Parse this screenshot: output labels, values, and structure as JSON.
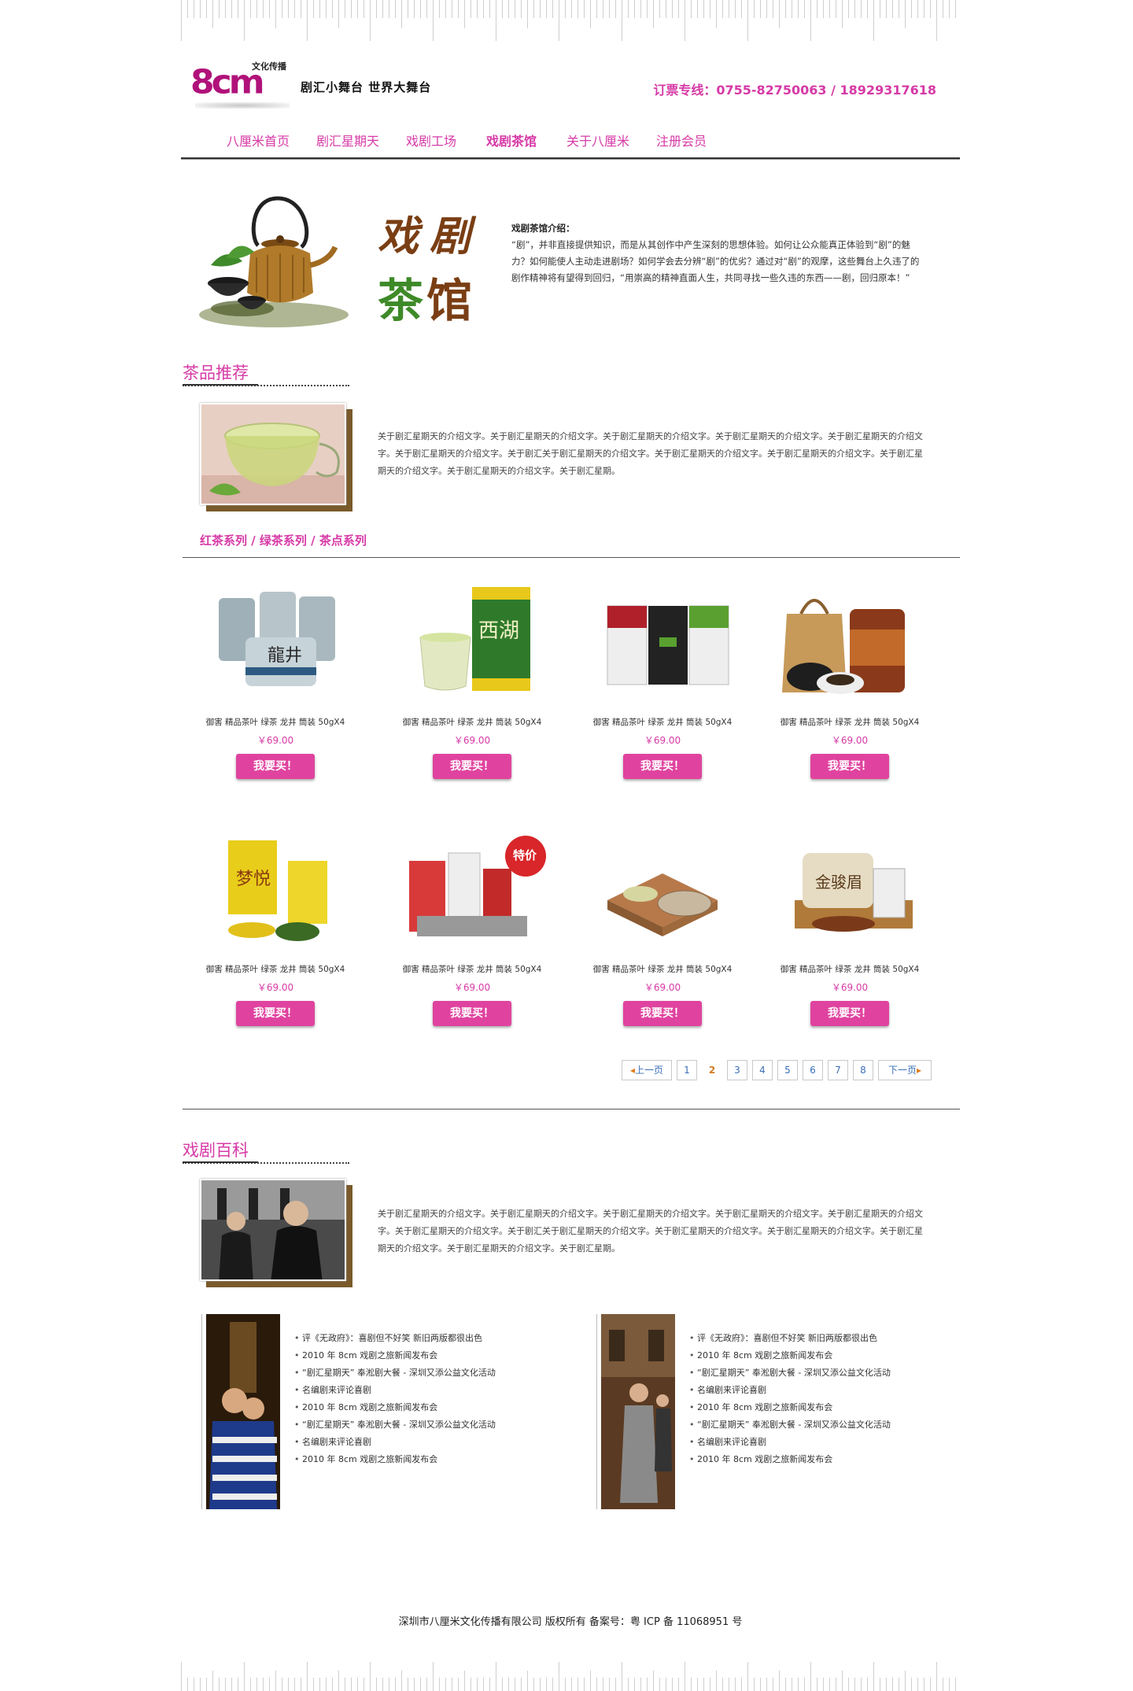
{
  "header": {
    "logo_text": "8cm",
    "logo_tag": "文化传播",
    "slogan": "剧汇小舞台  世界大舞台",
    "hotline": "订票专线：0755-82750063 / 18929317618"
  },
  "nav": [
    {
      "label": "八厘米首页"
    },
    {
      "label": "剧汇星期天"
    },
    {
      "label": "戏剧工场"
    },
    {
      "label": "戏剧茶馆",
      "active": true
    },
    {
      "label": "关于八厘米"
    },
    {
      "label": "注册会员"
    }
  ],
  "banner": {
    "title_line1": "戏剧",
    "title_line2a": "茶",
    "title_line2b": "馆",
    "intro_head": "戏剧茶馆介绍：",
    "intro_body": "“剧”，并非直接提供知识，而是从其创作中产生深刻的思想体验。如何让公众能真正体验到“剧”的魅力？如何能使人主动走进剧场？如何学会去分辨“剧”的优劣？通过对“剧”的观摩，这些舞台上久违了的剧作精神将有望得到回归，“用崇高的精神直面人生，共同寻找一些久违的东西——剧，回归原本！”"
  },
  "tea_section": {
    "title": "茶品推荐",
    "text": "关于剧汇星期天的介绍文字。关于剧汇星期天的介绍文字。关于剧汇星期天的介绍文字。关于剧汇星期天的介绍文字。关于剧汇星期天的介绍文字。关于剧汇星期天的介绍文字。关于剧汇关于剧汇星期天的介绍文字。关于剧汇星期天的介绍文字。关于剧汇星期天的介绍文字。关于剧汇星期天的介绍文字。关于剧汇星期天的介绍文字。关于剧汇星期。",
    "series": "红茶系列 / 绿茶系列 / 茶点系列"
  },
  "products": [
    {
      "name": "御害  精品茶叶  绿茶  龙井  筒装  50gX4",
      "price": "￥69.00",
      "buy": "我要买！"
    },
    {
      "name": "御害  精品茶叶  绿茶  龙井  筒装  50gX4",
      "price": "￥69.00",
      "buy": "我要买！"
    },
    {
      "name": "御害  精品茶叶  绿茶  龙井  筒装  50gX4",
      "price": "￥69.00",
      "buy": "我要买！"
    },
    {
      "name": "御害  精品茶叶  绿茶  龙井  筒装  50gX4",
      "price": "￥69.00",
      "buy": "我要买！"
    },
    {
      "name": "御害  精品茶叶  绿茶  龙井  筒装  50gX4",
      "price": "￥69.00",
      "buy": "我要买！"
    },
    {
      "name": "御害  精品茶叶  绿茶  龙井  筒装  50gX4",
      "price": "￥69.00",
      "buy": "我要买！",
      "badge": "特价"
    },
    {
      "name": "御害  精品茶叶  绿茶  龙井  筒装  50gX4",
      "price": "￥69.00",
      "buy": "我要买！"
    },
    {
      "name": "御害  精品茶叶  绿茶  龙井  筒装  50gX4",
      "price": "￥69.00",
      "buy": "我要买！"
    }
  ],
  "pager": {
    "prev": "上一页",
    "next": "下一页",
    "pages": [
      "1",
      "2",
      "3",
      "4",
      "5",
      "6",
      "7",
      "8"
    ],
    "current": "2"
  },
  "wiki_section": {
    "title": "戏剧百科",
    "text": "关于剧汇星期天的介绍文字。关于剧汇星期天的介绍文字。关于剧汇星期天的介绍文字。关于剧汇星期天的介绍文字。关于剧汇星期天的介绍文字。关于剧汇星期天的介绍文字。关于剧汇关于剧汇星期天的介绍文字。关于剧汇星期天的介绍文字。关于剧汇星期天的介绍文字。关于剧汇星期天的介绍文字。关于剧汇星期天的介绍文字。关于剧汇星期。",
    "list_left": [
      "评《无政府》：喜剧但不好笑  新旧两版都很出色",
      "2010 年 8cm 戏剧之旅新闻发布会",
      "“剧汇星期天” 奉淞剧大餐 - 深圳又添公益文化活动",
      "名编剧来评论喜剧",
      "2010 年 8cm 戏剧之旅新闻发布会",
      "“剧汇星期天” 奉淞剧大餐 - 深圳又添公益文化活动",
      "名编剧来评论喜剧",
      "2010 年 8cm 戏剧之旅新闻发布会"
    ],
    "list_right": [
      "评《无政府》：喜剧但不好笑  新旧两版都很出色",
      "2010 年 8cm 戏剧之旅新闻发布会",
      "“剧汇星期天” 奉淞剧大餐 - 深圳又添公益文化活动",
      "名编剧来评论喜剧",
      "2010 年 8cm 戏剧之旅新闻发布会",
      "“剧汇星期天” 奉淞剧大餐 - 深圳又添公益文化活动",
      "名编剧来评论喜剧",
      "2010 年 8cm 戏剧之旅新闻发布会"
    ]
  },
  "footer": {
    "text": "深圳市八厘米文化传播有限公司 版权所有    备案号：粤 ICP 备 11068951 号"
  },
  "colors": {
    "accent": "#d63aa6",
    "buy_button": "#e0439f",
    "brand": "#b0127a"
  }
}
